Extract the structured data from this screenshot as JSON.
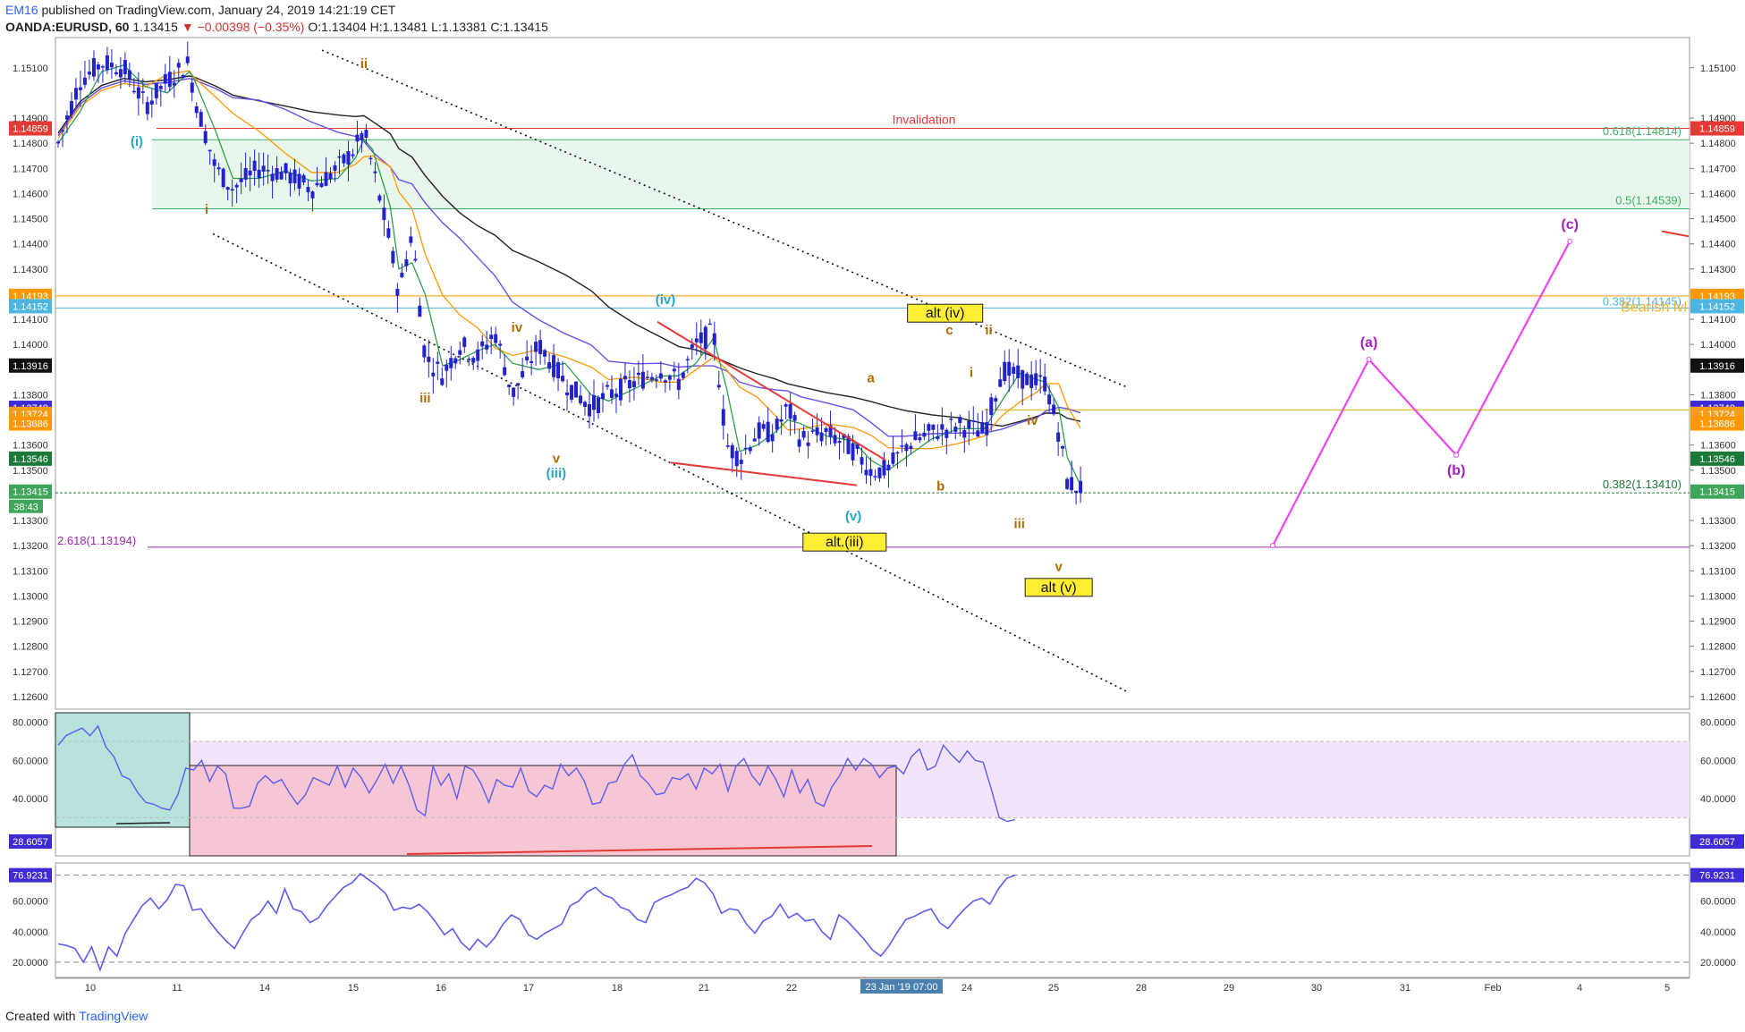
{
  "header": {
    "publisher": "EM16",
    "published_text": " published on TradingView.com, January 24, 2019 14:21:19 CET",
    "symbol_line": "OANDA:EURUSD, 60",
    "last": "1.13415",
    "change": "▼ −0.00398 (−0.35%)",
    "ohlc": "O:1.13404 H:1.13481 L:1.13381 C:1.13415"
  },
  "footer": {
    "created_with": "Created with",
    "brand": "TradingView"
  },
  "colors": {
    "candle": "#2222cc",
    "ema_green": "#2e9e4e",
    "ema_orange": "#ff9800",
    "ma_purple": "#6a4ee6",
    "ma_black": "#222222",
    "red": "#e53935",
    "magenta": "#ee44ee",
    "rsi": "#5c5cf2",
    "fill_green": "#e8f6ec",
    "fill_pink": "#f6c6d4",
    "fill_lilac": "#f1e4fb",
    "fill_teal": "#b7e3dc"
  },
  "chart_data": [
    {
      "type": "candlestick",
      "title": "OANDA:EURUSD, 60",
      "ylim": [
        1.1255,
        1.1522
      ],
      "y_ticks": [
        "1.15100",
        "1.14900",
        "1.14800",
        "1.14700",
        "1.14600",
        "1.14500",
        "1.14400",
        "1.14300",
        "1.14100",
        "1.14000",
        "1.13800",
        "1.13600",
        "1.13500",
        "1.13300",
        "1.13200",
        "1.13100",
        "1.13000",
        "1.12900",
        "1.12800",
        "1.12700",
        "1.12600"
      ],
      "x_ticks": [
        "10",
        "11",
        "14",
        "15",
        "16",
        "17",
        "18",
        "21",
        "22",
        "23 Jan '19  07:00",
        "24",
        "25",
        "28",
        "29",
        "30",
        "31",
        "Feb",
        "4",
        "5"
      ],
      "price_path": [
        [
          0.0,
          1.148
        ],
        [
          0.25,
          1.1505
        ],
        [
          0.5,
          1.1512
        ],
        [
          0.75,
          1.151
        ],
        [
          1.0,
          1.1495
        ],
        [
          1.25,
          1.1505
        ],
        [
          1.5,
          1.1512
        ],
        [
          1.55,
          1.15
        ],
        [
          1.8,
          1.147
        ],
        [
          2.0,
          1.1462
        ],
        [
          2.3,
          1.147
        ],
        [
          2.6,
          1.1468
        ],
        [
          2.9,
          1.1462
        ],
        [
          3.2,
          1.147
        ],
        [
          3.4,
          1.1478
        ],
        [
          3.5,
          1.1485
        ],
        [
          3.6,
          1.147
        ],
        [
          3.8,
          1.144
        ],
        [
          3.9,
          1.142
        ],
        [
          4.05,
          1.1445
        ],
        [
          4.2,
          1.1395
        ],
        [
          4.4,
          1.1388
        ],
        [
          4.6,
          1.14
        ],
        [
          4.8,
          1.1395
        ],
        [
          5.0,
          1.1405
        ],
        [
          5.2,
          1.138
        ],
        [
          5.5,
          1.14
        ],
        [
          5.8,
          1.1385
        ],
        [
          6.1,
          1.1375
        ],
        [
          6.3,
          1.138
        ],
        [
          6.6,
          1.1385
        ],
        [
          6.9,
          1.139
        ],
        [
          7.1,
          1.1385
        ],
        [
          7.3,
          1.14
        ],
        [
          7.5,
          1.1405
        ],
        [
          7.65,
          1.136
        ],
        [
          7.8,
          1.1355
        ],
        [
          8.0,
          1.1365
        ],
        [
          8.2,
          1.1365
        ],
        [
          8.35,
          1.1375
        ],
        [
          8.5,
          1.1362
        ],
        [
          8.8,
          1.1365
        ],
        [
          9.1,
          1.1358
        ],
        [
          9.3,
          1.135
        ],
        [
          9.5,
          1.135
        ],
        [
          9.7,
          1.136
        ],
        [
          10.0,
          1.1365
        ],
        [
          10.3,
          1.1368
        ],
        [
          10.6,
          1.1365
        ],
        [
          10.8,
          1.139
        ],
        [
          11.0,
          1.1387
        ],
        [
          11.2,
          1.1385
        ],
        [
          11.3,
          1.1385
        ],
        [
          11.45,
          1.1365
        ],
        [
          11.55,
          1.1345
        ],
        [
          11.7,
          1.1343
        ]
      ],
      "annotations": {
        "invalidation": {
          "text": "Invalidation",
          "price": 1.14859
        },
        "fib_0618": {
          "text": "0.618(1.14814)",
          "price": 1.14814
        },
        "fib_05": {
          "text": "0.5(1.14539)",
          "price": 1.14539
        },
        "fib_0382_upper": {
          "text": "0.382(1.14145)",
          "price": 1.14145
        },
        "bearish_lvl": {
          "text": "Bearish lvl",
          "price": 1.14145
        },
        "fib_0382_lower": {
          "text": "0.382(1.13410)",
          "price": 1.1341
        },
        "fib_2618": {
          "text": "2.618(1.13194)",
          "price": 1.13194
        },
        "orange_level": 1.14193,
        "yellow_level": 1.1374,
        "wave_labels": [
          {
            "text": "(i)",
            "x": 0.9,
            "price": 1.1479,
            "color": "#26a6c4"
          },
          {
            "text": "i",
            "x": 1.7,
            "price": 1.1452,
            "color": "#b06a00"
          },
          {
            "text": "ii",
            "x": 3.5,
            "price": 1.151,
            "color": "#b06a00"
          },
          {
            "text": "iii",
            "x": 4.2,
            "price": 1.1377,
            "color": "#b06a00"
          },
          {
            "text": "iv",
            "x": 5.25,
            "price": 1.1405,
            "color": "#b06a00"
          },
          {
            "text": "v",
            "x": 5.7,
            "price": 1.1353,
            "color": "#b06a00"
          },
          {
            "text": "(iii)",
            "x": 5.7,
            "price": 1.1347,
            "color": "#26a6c4"
          },
          {
            "text": "(iv)",
            "x": 6.95,
            "price": 1.1416,
            "color": "#26a6c4"
          },
          {
            "text": "a",
            "x": 9.3,
            "price": 1.1385,
            "color": "#b06a00"
          },
          {
            "text": "b",
            "x": 10.1,
            "price": 1.1342,
            "color": "#b06a00"
          },
          {
            "text": "(v)",
            "x": 9.1,
            "price": 1.133,
            "color": "#26a6c4"
          },
          {
            "text": "c",
            "x": 10.2,
            "price": 1.1404,
            "color": "#b06a00"
          },
          {
            "text": "ii",
            "x": 10.65,
            "price": 1.1404,
            "color": "#b06a00"
          },
          {
            "text": "i",
            "x": 10.45,
            "price": 1.1387,
            "color": "#b06a00"
          },
          {
            "text": "iv",
            "x": 11.15,
            "price": 1.1368,
            "color": "#b06a00"
          },
          {
            "text": "iii",
            "x": 11.0,
            "price": 1.1327,
            "color": "#b06a00"
          },
          {
            "text": "v",
            "x": 11.45,
            "price": 1.131,
            "color": "#b06a00"
          }
        ],
        "boxed_labels": [
          {
            "text": "alt (iv)",
            "x": 10.15,
            "price": 1.1411
          },
          {
            "text": "alt.(iii)",
            "x": 9.0,
            "price": 1.132
          },
          {
            "text": "alt (v)",
            "x": 11.45,
            "price": 1.1302
          }
        ],
        "projection": [
          {
            "text": "",
            "x": 13.9,
            "price": 1.132
          },
          {
            "text": "(a)",
            "x": 15.0,
            "price": 1.1394
          },
          {
            "text": "(b)",
            "x": 16.0,
            "price": 1.1356
          },
          {
            "text": "(c)",
            "x": 17.3,
            "price": 1.1441
          }
        ]
      }
    },
    {
      "type": "line",
      "title": "RSI pane 1",
      "ylim": [
        10,
        85
      ],
      "y_ticks": [
        "80.0000",
        "60.0000",
        "40.0000"
      ],
      "last_value": "28.6057",
      "values": [
        68,
        73,
        75,
        77,
        73,
        78,
        67,
        62,
        52,
        50,
        43,
        38,
        37,
        35,
        34,
        42,
        56,
        55,
        60,
        49,
        57,
        53,
        35,
        35,
        36,
        48,
        52,
        48,
        50,
        43,
        37,
        42,
        51,
        49,
        47,
        57,
        46,
        56,
        51,
        43,
        50,
        58,
        48,
        57,
        47,
        34,
        31,
        57,
        47,
        53,
        40,
        57,
        55,
        48,
        38,
        50,
        47,
        46,
        56,
        44,
        41,
        47,
        45,
        58,
        52,
        56,
        49,
        37,
        38,
        48,
        49,
        58,
        63,
        52,
        48,
        42,
        43,
        51,
        50,
        53,
        45,
        56,
        53,
        58,
        44,
        57,
        61,
        52,
        47,
        57,
        50,
        41,
        55,
        43,
        50,
        38,
        36,
        46,
        52,
        61,
        55,
        61,
        58,
        51,
        56,
        57,
        53,
        62,
        66,
        55,
        57,
        68,
        63,
        59,
        65,
        60,
        59,
        45,
        30,
        28,
        29
      ],
      "legend_note": ""
    },
    {
      "type": "line",
      "title": "RSI pane 2",
      "ylim": [
        10,
        85
      ],
      "y_ticks": [
        "60.0000",
        "40.0000",
        "20.0000"
      ],
      "last_value": "76.9231",
      "values": [
        32,
        31,
        29,
        20,
        30,
        15,
        30,
        24,
        39,
        48,
        57,
        62,
        55,
        61,
        71,
        70,
        54,
        55,
        47,
        40,
        34,
        29,
        39,
        48,
        52,
        60,
        52,
        68,
        55,
        53,
        46,
        49,
        57,
        63,
        69,
        72,
        78,
        74,
        70,
        65,
        54,
        56,
        55,
        58,
        53,
        46,
        38,
        42,
        33,
        28,
        35,
        30,
        36,
        45,
        51,
        48,
        38,
        35,
        39,
        42,
        45,
        57,
        60,
        66,
        69,
        64,
        62,
        56,
        54,
        48,
        46,
        59,
        62,
        64,
        67,
        69,
        75,
        72,
        65,
        52,
        55,
        54,
        45,
        39,
        47,
        50,
        58,
        49,
        52,
        47,
        48,
        40,
        35,
        51,
        47,
        41,
        35,
        28,
        24,
        31,
        40,
        48,
        50,
        53,
        55,
        46,
        42,
        49,
        55,
        60,
        62,
        58,
        68,
        75,
        77
      ]
    }
  ],
  "price_tags": [
    {
      "text": "1.14859",
      "price": 1.14859,
      "bg": "#e53935"
    },
    {
      "text": "1.14193",
      "price": 1.14193,
      "bg": "#ff9800"
    },
    {
      "text": "1.14152",
      "price": 1.14152,
      "bg": "#4db6e0"
    },
    {
      "text": "1.13916",
      "price": 1.13916,
      "bg": "#111111"
    },
    {
      "text": "1.13748",
      "price": 1.13748,
      "bg": "#3f2bd6"
    },
    {
      "text": "1.13724",
      "price": 1.13724,
      "bg": "#f59c1a"
    },
    {
      "text": "1.13686",
      "price": 1.13686,
      "bg": "#ff9800"
    },
    {
      "text": "1.13546",
      "price": 1.13546,
      "bg": "#1b7a3a"
    },
    {
      "text": "1.13415",
      "price": 1.13415,
      "bg": "#3fa55a"
    }
  ],
  "countdown": "38:43"
}
